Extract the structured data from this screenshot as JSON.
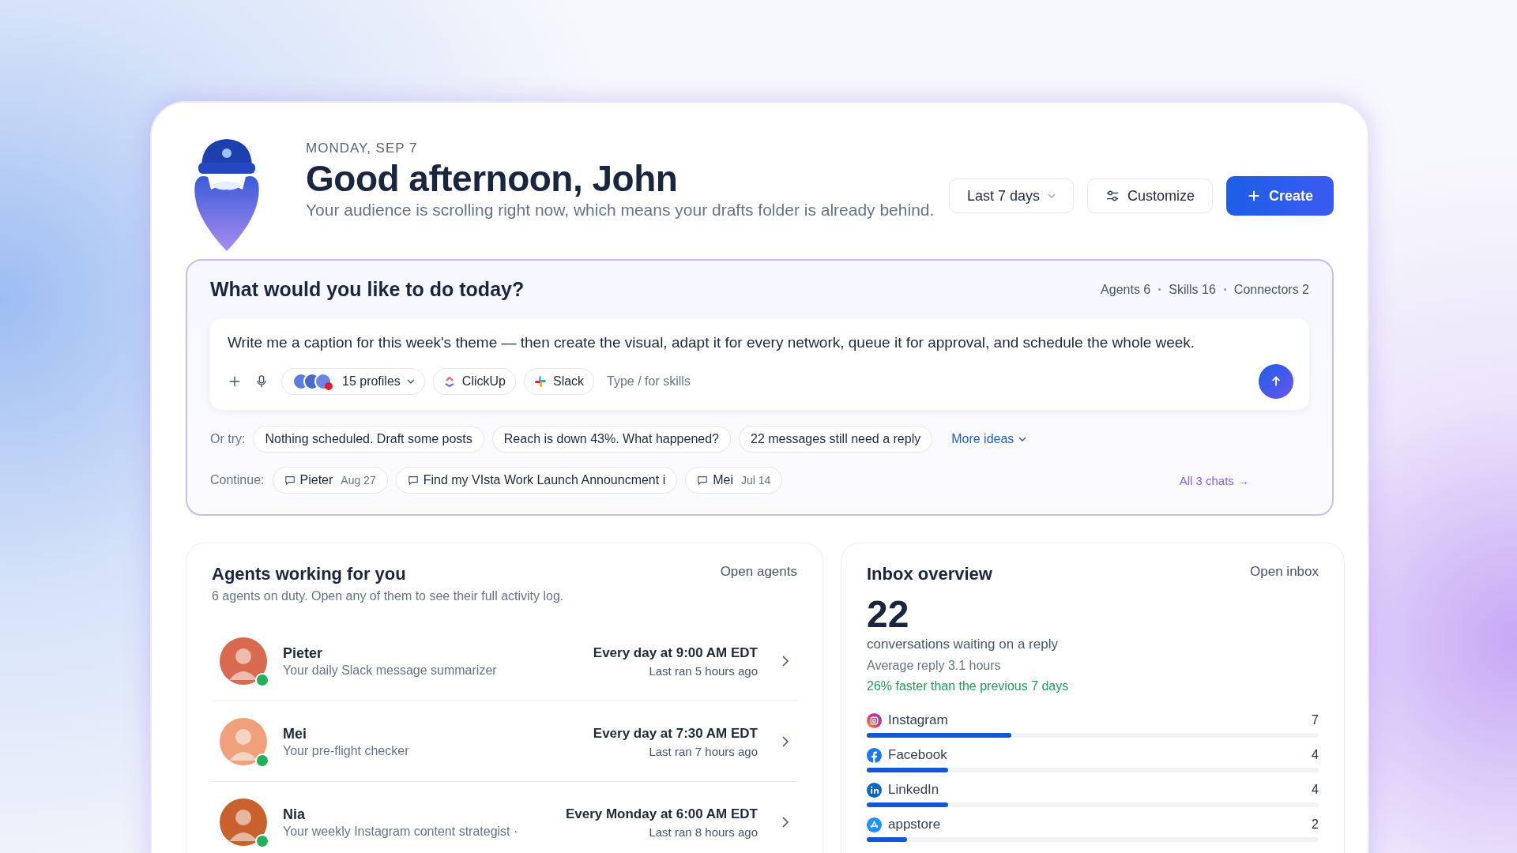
{
  "header": {
    "date": "MONDAY, SEP 7",
    "greeting": "Good afternoon, John",
    "subtitle": "Your audience is scrolling right now, which means your drafts folder is already behind.",
    "range": "Last 7 days",
    "customize": "Customize",
    "create": "Create"
  },
  "prompt": {
    "title": "What would you like to do today?",
    "stats": [
      "Agents 6",
      "Skills 16",
      "Connectors 2"
    ],
    "input": {
      "value": "Write me a caption for this week's theme — then create the visual, adapt it for every network, queue it for approval, and schedule the whole week.",
      "profiles": "15 profiles",
      "tools": [
        {
          "kind": "clickup",
          "label": "ClickUp"
        },
        {
          "kind": "slack",
          "label": "Slack"
        }
      ],
      "hint": "Type / for skills"
    },
    "suggestions": {
      "label": "Or try:",
      "items": [
        "Nothing scheduled. Draft some posts",
        "Reach is down 43%. What happened?",
        "22 messages still need a reply"
      ],
      "more": "More ideas"
    },
    "continue": {
      "label": "Continue:",
      "chats": [
        {
          "title": "Pieter",
          "date": "Aug 27"
        },
        {
          "title": "Find my VIsta Work Launch Announcment i"
        },
        {
          "title": "Mei",
          "date": "Jul 14"
        }
      ],
      "all": "All 3 chats →"
    }
  },
  "agents": {
    "title": "Agents working for you",
    "subtitle": "6 agents on duty. Open any of them to see their full activity log.",
    "open": "Open agents",
    "items": [
      {
        "name": "Pieter",
        "role": "Your daily Slack message summarizer",
        "schedule": "Every day at 9:00 AM EDT",
        "last_run": "Last ran 5 hours ago",
        "online": true,
        "color": "#d9694f"
      },
      {
        "name": "Mei",
        "role": "Your pre-flight checker",
        "schedule": "Every day at 7:30 AM EDT",
        "last_run": "Last ran 7 hours ago",
        "online": true,
        "color": "#f0a07a"
      },
      {
        "name": "Nia",
        "role": "Your weekly Instagram content strategist ·",
        "schedule": "Every Monday at 6:00 AM EDT",
        "last_run": "Last ran 8 hours ago",
        "online": true,
        "color": "#c8612e"
      }
    ]
  },
  "inbox": {
    "title": "Inbox overview",
    "open": "Open inbox",
    "count": "22",
    "caption": "conversations waiting on a reply",
    "average": "Average reply 3.1 hours",
    "trend": "26% faster than the previous 7 days",
    "channels": [
      {
        "kind": "instagram",
        "name": "Instagram",
        "count": "7",
        "level": 0.32
      },
      {
        "kind": "facebook",
        "name": "Facebook",
        "count": "4",
        "level": 0.18
      },
      {
        "kind": "linkedin",
        "name": "LinkedIn",
        "count": "4",
        "level": 0.18
      },
      {
        "kind": "appstore",
        "name": "appstore",
        "count": "2",
        "level": 0.09
      }
    ]
  }
}
